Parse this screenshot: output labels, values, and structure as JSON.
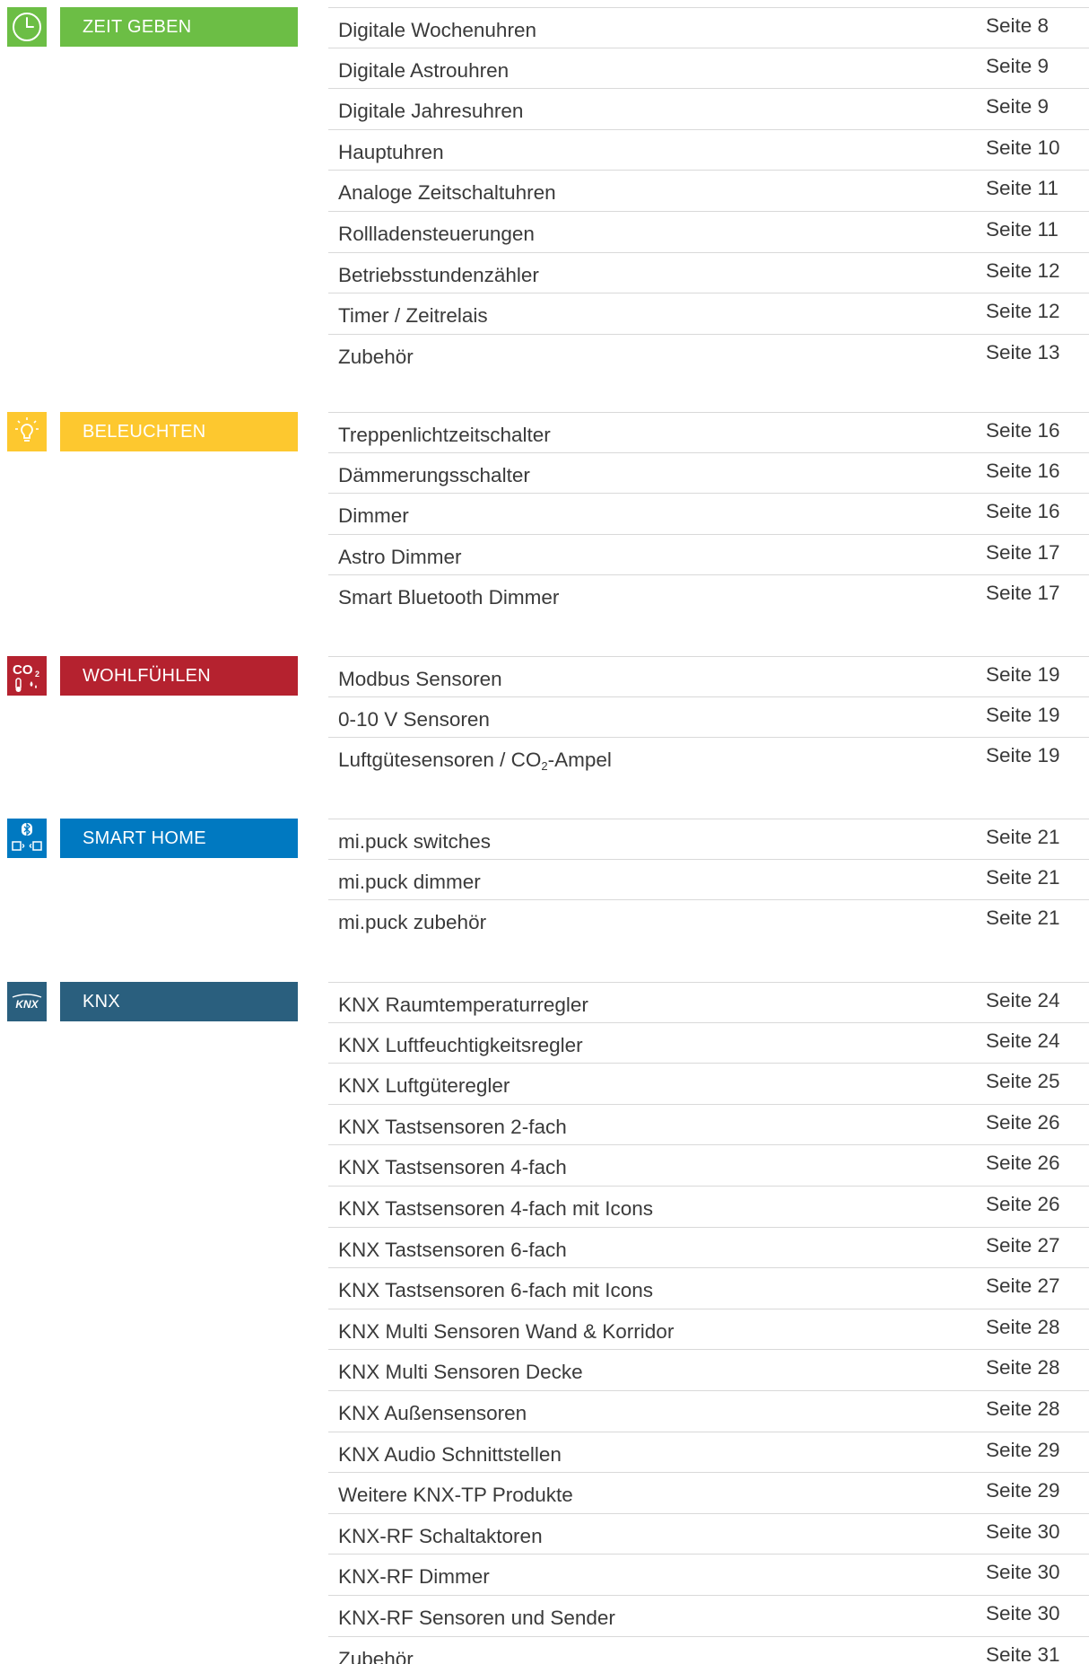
{
  "sections": [
    {
      "key": "zeit",
      "label": "ZEIT GEBEN",
      "icon": "clock-icon",
      "color": "#6cbe45",
      "items": [
        {
          "name": "Digitale Wochenuhren",
          "page": "Seite 8"
        },
        {
          "name": "Digitale Astrouhren",
          "page": "Seite 9"
        },
        {
          "name": "Digitale Jahresuhren",
          "page": "Seite 9"
        },
        {
          "name": "Hauptuhren",
          "page": "Seite 10"
        },
        {
          "name": "Analoge Zeitschaltuhren",
          "page": "Seite 11"
        },
        {
          "name": "Rollladensteuerungen",
          "page": "Seite 11"
        },
        {
          "name": "Betriebsstundenzähler",
          "page": "Seite 12"
        },
        {
          "name": "Timer / Zeitrelais",
          "page": "Seite 12"
        },
        {
          "name": "Zubehör",
          "page": "Seite 13"
        }
      ]
    },
    {
      "key": "licht",
      "label": "BELEUCHTEN",
      "icon": "lightbulb-icon",
      "color": "#fdc82f",
      "items": [
        {
          "name": "Treppenlichtzeitschalter",
          "page": "Seite 16"
        },
        {
          "name": "Dämmerungsschalter",
          "page": "Seite 16"
        },
        {
          "name": "Dimmer",
          "page": "Seite 16"
        },
        {
          "name": "Astro Dimmer",
          "page": "Seite 17"
        },
        {
          "name": "Smart Bluetooth Dimmer",
          "page": "Seite 17"
        }
      ]
    },
    {
      "key": "wohl",
      "label": "WOHLFÜHLEN",
      "icon": "co2-thermometer-icon",
      "icon_text": "CO",
      "icon_sub": "2",
      "color": "#b5222f",
      "items": [
        {
          "name": "Modbus Sensoren",
          "page": "Seite 19"
        },
        {
          "name": "0-10 V Sensoren",
          "page": "Seite 19"
        },
        {
          "name_prefix": "Luftgütesensoren / CO",
          "name_sub": "2",
          "name_suffix": "-Ampel",
          "page": "Seite 19"
        }
      ]
    },
    {
      "key": "smart",
      "label": "SMART HOME",
      "icon": "bluetooth-devices-icon",
      "color": "#0079c1",
      "items": [
        {
          "name": "mi.puck switches",
          "page": "Seite 21"
        },
        {
          "name": "mi.puck dimmer",
          "page": "Seite 21"
        },
        {
          "name": "mi.puck zubehör",
          "page": "Seite 21"
        }
      ]
    },
    {
      "key": "knx",
      "label": "KNX",
      "icon": "knx-logo-icon",
      "icon_text": "KNX",
      "color": "#2a5f7e",
      "items": [
        {
          "name": "KNX Raumtemperaturregler",
          "page": "Seite 24"
        },
        {
          "name": "KNX Luftfeuchtigkeitsregler",
          "page": "Seite 24"
        },
        {
          "name": "KNX Luftgüteregler",
          "page": "Seite 25"
        },
        {
          "name": "KNX Tastsensoren 2-fach",
          "page": "Seite 26"
        },
        {
          "name": "KNX Tastsensoren 4-fach",
          "page": "Seite 26"
        },
        {
          "name": "KNX Tastsensoren 4-fach mit Icons",
          "page": "Seite 26"
        },
        {
          "name": "KNX Tastsensoren 6-fach",
          "page": "Seite 27"
        },
        {
          "name": "KNX Tastsensoren 6-fach mit Icons",
          "page": "Seite 27"
        },
        {
          "name": "KNX Multi Sensoren Wand & Korridor",
          "page": "Seite 28"
        },
        {
          "name": "KNX Multi Sensoren Decke",
          "page": "Seite 28"
        },
        {
          "name": "KNX Außensensoren",
          "page": "Seite 28"
        },
        {
          "name": "KNX Audio Schnittstellen",
          "page": "Seite 29"
        },
        {
          "name": "Weitere KNX-TP Produkte",
          "page": "Seite 29"
        },
        {
          "name": "KNX-RF Schaltaktoren",
          "page": "Seite 30"
        },
        {
          "name": "KNX-RF Dimmer",
          "page": "Seite 30"
        },
        {
          "name": "KNX-RF Sensoren und Sender",
          "page": "Seite 30"
        },
        {
          "name": "Zubehör",
          "page": "Seite 31"
        }
      ]
    }
  ]
}
